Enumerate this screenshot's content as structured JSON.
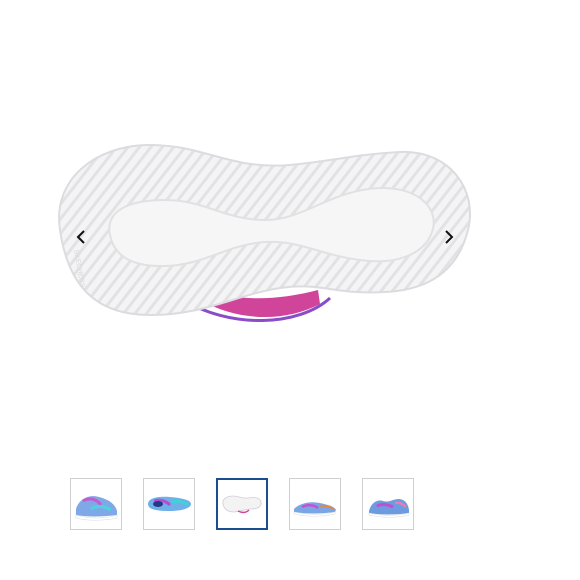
{
  "gallery": {
    "main_image": {
      "icon": "shoe-sole-image",
      "sole_color": "#f3f3f4",
      "accent_color": "#d0459a"
    },
    "prev_icon": "chevron-left-icon",
    "next_icon": "chevron-right-icon",
    "active_thumbnail_index": 2,
    "thumbnails": [
      {
        "icon": "shoe-side-view-image"
      },
      {
        "icon": "shoe-top-view-image"
      },
      {
        "icon": "shoe-sole-image"
      },
      {
        "icon": "shoe-pair-image"
      },
      {
        "icon": "shoe-back-view-image"
      }
    ],
    "colors": {
      "active_border": "#1a4f8f",
      "thumb_border": "#cfcfcf"
    }
  }
}
